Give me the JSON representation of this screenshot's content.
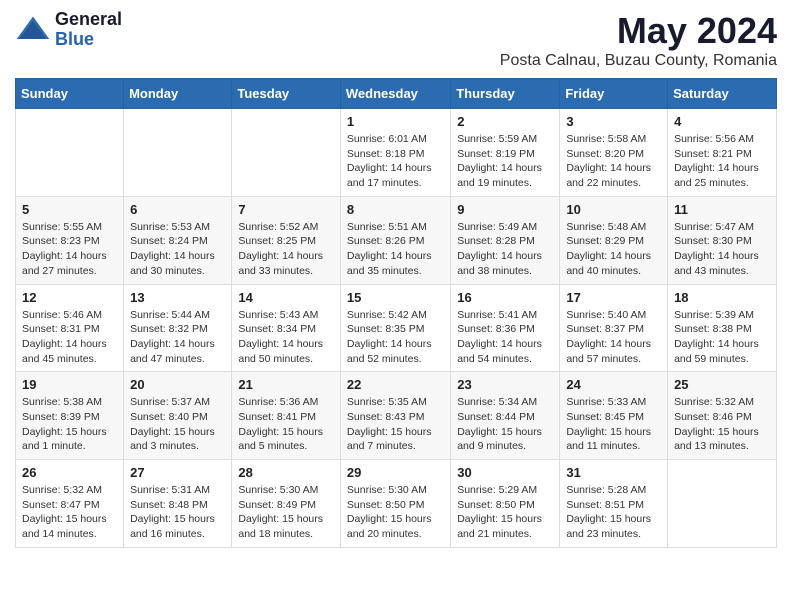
{
  "logo": {
    "general": "General",
    "blue": "Blue"
  },
  "title": "May 2024",
  "location": "Posta Calnau, Buzau County, Romania",
  "headers": [
    "Sunday",
    "Monday",
    "Tuesday",
    "Wednesday",
    "Thursday",
    "Friday",
    "Saturday"
  ],
  "weeks": [
    [
      {
        "day": "",
        "info": ""
      },
      {
        "day": "",
        "info": ""
      },
      {
        "day": "",
        "info": ""
      },
      {
        "day": "1",
        "info": "Sunrise: 6:01 AM\nSunset: 8:18 PM\nDaylight: 14 hours and 17 minutes."
      },
      {
        "day": "2",
        "info": "Sunrise: 5:59 AM\nSunset: 8:19 PM\nDaylight: 14 hours and 19 minutes."
      },
      {
        "day": "3",
        "info": "Sunrise: 5:58 AM\nSunset: 8:20 PM\nDaylight: 14 hours and 22 minutes."
      },
      {
        "day": "4",
        "info": "Sunrise: 5:56 AM\nSunset: 8:21 PM\nDaylight: 14 hours and 25 minutes."
      }
    ],
    [
      {
        "day": "5",
        "info": "Sunrise: 5:55 AM\nSunset: 8:23 PM\nDaylight: 14 hours and 27 minutes."
      },
      {
        "day": "6",
        "info": "Sunrise: 5:53 AM\nSunset: 8:24 PM\nDaylight: 14 hours and 30 minutes."
      },
      {
        "day": "7",
        "info": "Sunrise: 5:52 AM\nSunset: 8:25 PM\nDaylight: 14 hours and 33 minutes."
      },
      {
        "day": "8",
        "info": "Sunrise: 5:51 AM\nSunset: 8:26 PM\nDaylight: 14 hours and 35 minutes."
      },
      {
        "day": "9",
        "info": "Sunrise: 5:49 AM\nSunset: 8:28 PM\nDaylight: 14 hours and 38 minutes."
      },
      {
        "day": "10",
        "info": "Sunrise: 5:48 AM\nSunset: 8:29 PM\nDaylight: 14 hours and 40 minutes."
      },
      {
        "day": "11",
        "info": "Sunrise: 5:47 AM\nSunset: 8:30 PM\nDaylight: 14 hours and 43 minutes."
      }
    ],
    [
      {
        "day": "12",
        "info": "Sunrise: 5:46 AM\nSunset: 8:31 PM\nDaylight: 14 hours and 45 minutes."
      },
      {
        "day": "13",
        "info": "Sunrise: 5:44 AM\nSunset: 8:32 PM\nDaylight: 14 hours and 47 minutes."
      },
      {
        "day": "14",
        "info": "Sunrise: 5:43 AM\nSunset: 8:34 PM\nDaylight: 14 hours and 50 minutes."
      },
      {
        "day": "15",
        "info": "Sunrise: 5:42 AM\nSunset: 8:35 PM\nDaylight: 14 hours and 52 minutes."
      },
      {
        "day": "16",
        "info": "Sunrise: 5:41 AM\nSunset: 8:36 PM\nDaylight: 14 hours and 54 minutes."
      },
      {
        "day": "17",
        "info": "Sunrise: 5:40 AM\nSunset: 8:37 PM\nDaylight: 14 hours and 57 minutes."
      },
      {
        "day": "18",
        "info": "Sunrise: 5:39 AM\nSunset: 8:38 PM\nDaylight: 14 hours and 59 minutes."
      }
    ],
    [
      {
        "day": "19",
        "info": "Sunrise: 5:38 AM\nSunset: 8:39 PM\nDaylight: 15 hours and 1 minute."
      },
      {
        "day": "20",
        "info": "Sunrise: 5:37 AM\nSunset: 8:40 PM\nDaylight: 15 hours and 3 minutes."
      },
      {
        "day": "21",
        "info": "Sunrise: 5:36 AM\nSunset: 8:41 PM\nDaylight: 15 hours and 5 minutes."
      },
      {
        "day": "22",
        "info": "Sunrise: 5:35 AM\nSunset: 8:43 PM\nDaylight: 15 hours and 7 minutes."
      },
      {
        "day": "23",
        "info": "Sunrise: 5:34 AM\nSunset: 8:44 PM\nDaylight: 15 hours and 9 minutes."
      },
      {
        "day": "24",
        "info": "Sunrise: 5:33 AM\nSunset: 8:45 PM\nDaylight: 15 hours and 11 minutes."
      },
      {
        "day": "25",
        "info": "Sunrise: 5:32 AM\nSunset: 8:46 PM\nDaylight: 15 hours and 13 minutes."
      }
    ],
    [
      {
        "day": "26",
        "info": "Sunrise: 5:32 AM\nSunset: 8:47 PM\nDaylight: 15 hours and 14 minutes."
      },
      {
        "day": "27",
        "info": "Sunrise: 5:31 AM\nSunset: 8:48 PM\nDaylight: 15 hours and 16 minutes."
      },
      {
        "day": "28",
        "info": "Sunrise: 5:30 AM\nSunset: 8:49 PM\nDaylight: 15 hours and 18 minutes."
      },
      {
        "day": "29",
        "info": "Sunrise: 5:30 AM\nSunset: 8:50 PM\nDaylight: 15 hours and 20 minutes."
      },
      {
        "day": "30",
        "info": "Sunrise: 5:29 AM\nSunset: 8:50 PM\nDaylight: 15 hours and 21 minutes."
      },
      {
        "day": "31",
        "info": "Sunrise: 5:28 AM\nSunset: 8:51 PM\nDaylight: 15 hours and 23 minutes."
      },
      {
        "day": "",
        "info": ""
      }
    ]
  ]
}
